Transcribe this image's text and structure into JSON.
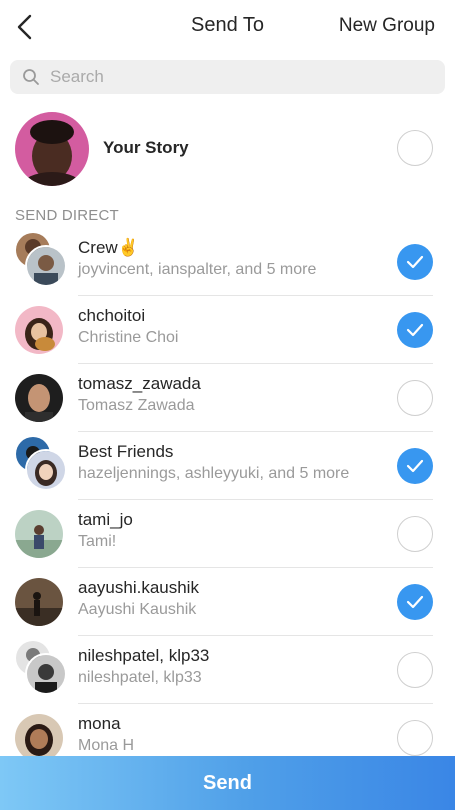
{
  "header": {
    "title": "Send To",
    "new_group": "New Group"
  },
  "search": {
    "placeholder": "Search"
  },
  "story": {
    "label": "Your Story",
    "selected": false
  },
  "section": {
    "title": "SEND DIRECT"
  },
  "recipients": [
    {
      "name": "Crew✌",
      "subtitle": "joyvincent, ianspalter, and 5 more",
      "selected": true,
      "group": true
    },
    {
      "name": "chchoitoi",
      "subtitle": "Christine Choi",
      "selected": true,
      "group": false
    },
    {
      "name": "tomasz_zawada",
      "subtitle": "Tomasz Zawada",
      "selected": false,
      "group": false
    },
    {
      "name": "Best Friends",
      "subtitle": "hazeljennings, ashleyyuki, and 5 more",
      "selected": true,
      "group": true
    },
    {
      "name": "tami_jo",
      "subtitle": "Tami!",
      "selected": false,
      "group": false
    },
    {
      "name": "aayushi.kaushik",
      "subtitle": "Aayushi Kaushik",
      "selected": true,
      "group": false
    },
    {
      "name": "nileshpatel, klp33",
      "subtitle": "nileshpatel, klp33",
      "selected": false,
      "group": true
    },
    {
      "name": "mona",
      "subtitle": "Mona H",
      "selected": false,
      "group": false
    }
  ],
  "send": {
    "label": "Send"
  },
  "colors": {
    "accent": "#3897f0",
    "unselected_border": "#cfcfcf"
  }
}
